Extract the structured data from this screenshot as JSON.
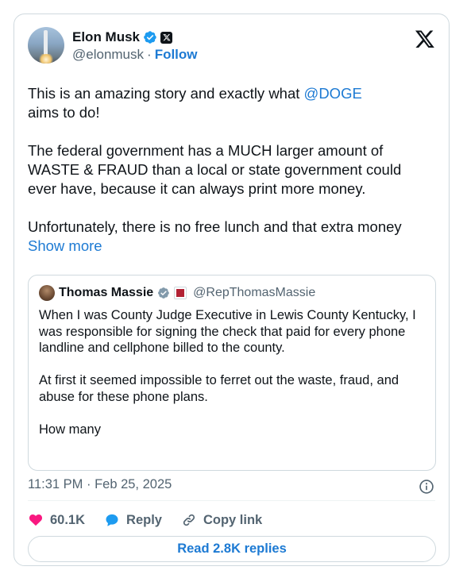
{
  "author": {
    "name": "Elon Musk",
    "handle": "@elonmusk",
    "separator": "·",
    "follow_label": "Follow"
  },
  "tweet": {
    "line1_prefix": "This is an amazing story and exactly what ",
    "mention": "@DOGE",
    "line1_suffix": "aims to do!",
    "paragraph2": "The federal government has a MUCH larger amount of WASTE & FRAUD than a local or state government could ever have, because it can always print more money.",
    "paragraph3": "Unfortunately, there is no free lunch and that extra money ",
    "show_more": "Show more"
  },
  "quote": {
    "name": "Thomas Massie",
    "handle": "@RepThomasMassie",
    "paragraph1": "When I was County Judge Executive in Lewis County Kentucky, I was responsible for signing the check that paid for every phone landline and cellphone billed to the county.",
    "paragraph2": "At first it seemed impossible to ferret out the waste, fraud, and abuse for these phone plans.",
    "paragraph3": "How many"
  },
  "timestamp": "11:31 PM · Feb 25, 2025",
  "actions": {
    "likes": "60.1K",
    "reply_label": "Reply",
    "copy_link_label": "Copy link"
  },
  "read_replies_label": "Read 2.8K replies",
  "colors": {
    "link_blue": "#1d7ad3",
    "verified_blue": "#1d9bf0",
    "heart_pink": "#f91880",
    "muted_text": "#536471",
    "border": "#cfd9de"
  }
}
